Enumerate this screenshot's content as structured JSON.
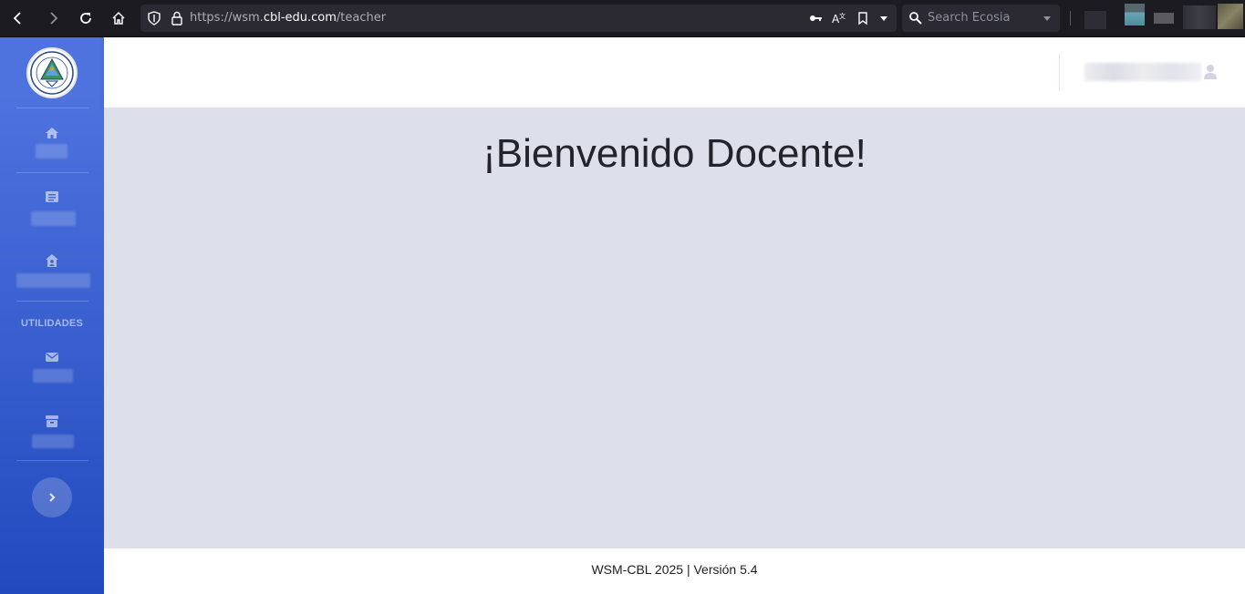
{
  "browser": {
    "url_prefix": "https://wsm.",
    "url_host": "cbl-edu.com",
    "url_path": "/teacher",
    "search_placeholder": "Search Ecosia"
  },
  "sidebar": {
    "heading": "UTILIDADES",
    "items": [
      {
        "icon": "home-icon"
      },
      {
        "icon": "list-icon"
      },
      {
        "icon": "house-user-icon"
      },
      {
        "icon": "envelope-icon"
      },
      {
        "icon": "archive-icon"
      }
    ]
  },
  "main": {
    "title": "¡Bienvenido Docente!"
  },
  "footer": {
    "text": "WSM-CBL 2025 | Versión 5.4"
  },
  "colors": {
    "sidebar_top": "#4e73df",
    "sidebar_bottom": "#224abe",
    "content_bg": "#dddfea"
  }
}
